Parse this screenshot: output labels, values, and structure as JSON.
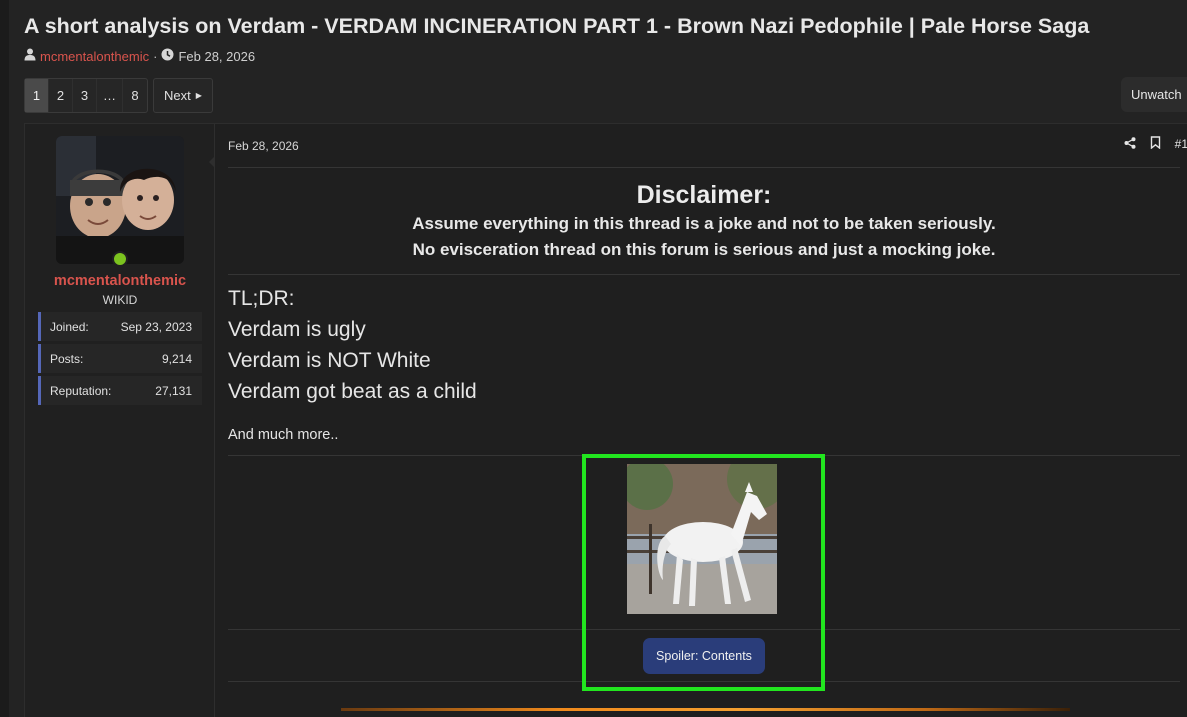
{
  "thread": {
    "title": "A short analysis on Verdam - VERDAM INCINERATION PART 1 - Brown Nazi Pedophile | Pale Horse Saga",
    "author": "mcmentalonthemic",
    "separator": "·",
    "date": "Feb 28, 2026"
  },
  "pagination": {
    "pages": [
      "1",
      "2",
      "3",
      "…",
      "8"
    ],
    "current": "1",
    "next_label": "Next"
  },
  "watch": {
    "label": "Unwatch"
  },
  "user": {
    "name": "mcmentalonthemic",
    "title": "WIKID",
    "stats": [
      {
        "label": "Joined:",
        "value": "Sep 23, 2023"
      },
      {
        "label": "Posts:",
        "value": "9,214"
      },
      {
        "label": "Reputation:",
        "value": "27,131"
      }
    ]
  },
  "post": {
    "date": "Feb 28, 2026",
    "number": "#1",
    "disclaimer_heading": "Disclaimer:",
    "disclaimer_lines": [
      "Assume everything in this thread is a joke and not to be taken seriously.",
      "No evisceration thread on this forum is serious and just a mocking joke."
    ],
    "tldr_lines": [
      "TL;DR:",
      "Verdam is ugly",
      "Verdam is NOT White",
      "Verdam got beat as a child"
    ],
    "more_text": "And much more..",
    "spoiler_label": "Spoiler: Contents"
  },
  "colors": {
    "background": "#232323",
    "username": "#d9544d",
    "stat_accent": "#5567b8",
    "spoiler_button": "#2a3d7a",
    "highlight_box": "#22e61f",
    "online": "#7cc31f"
  },
  "icons": [
    "user-icon",
    "clock-icon",
    "share-icon",
    "bookmark-icon",
    "caret-right-icon"
  ]
}
